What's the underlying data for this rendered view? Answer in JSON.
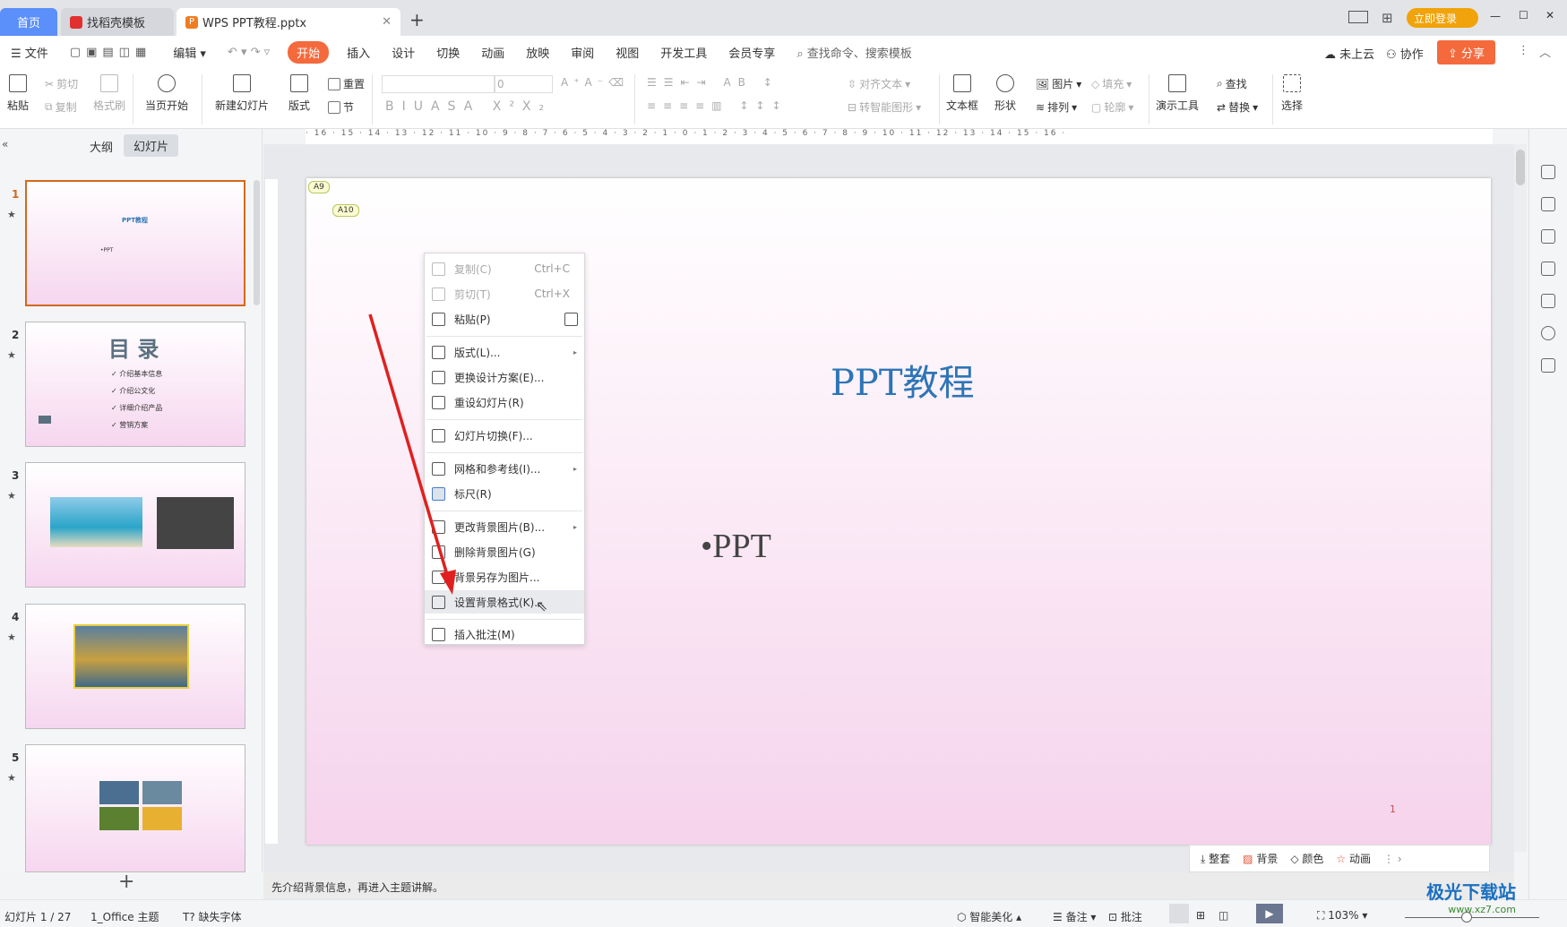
{
  "tabs": {
    "home": "首页",
    "template": "找稻壳模板",
    "doc": "WPS PPT教程.pptx",
    "add": "+"
  },
  "titlebar": {
    "login": "立即登录",
    "min": "—",
    "max": "☐",
    "close": "✕"
  },
  "menu": {
    "file": "文件",
    "edit": "编辑",
    "items": [
      "开始",
      "插入",
      "设计",
      "切换",
      "动画",
      "放映",
      "审阅",
      "视图",
      "开发工具",
      "会员专享"
    ],
    "search": "查找命令、搜索模板",
    "cloud": "未上云",
    "collab": "协作",
    "share": "分享"
  },
  "ribbon": {
    "paste": "粘贴",
    "cut": "剪切",
    "copy": "复制",
    "format_painter": "格式刷",
    "from_start": "当页开始",
    "new_slide": "新建幻灯片",
    "layout": "版式",
    "reset": "重置",
    "section": "节",
    "font_size": "0",
    "align_text": "对齐文本",
    "smart_shape": "转智能图形",
    "textbox": "文本框",
    "shape": "形状",
    "picture": "图片",
    "arrange": "排列",
    "fill": "填充",
    "outline": "轮廓",
    "present_tools": "演示工具",
    "find": "查找",
    "replace": "替换",
    "select": "选择"
  },
  "panel": {
    "outline_tab": "大纲",
    "slides_tab": "幻灯片",
    "add": "+"
  },
  "slides": [
    {
      "num": "1",
      "title": "PPT教程",
      "bullet": "•PPT"
    },
    {
      "num": "2",
      "title": "目 录",
      "items": [
        "✓ 介绍基本信息",
        "✓ 介绍公文化",
        "✓ 详细介绍产品",
        "✓ 营销方案"
      ]
    },
    {
      "num": "3"
    },
    {
      "num": "4"
    },
    {
      "num": "5"
    }
  ],
  "ruler": "· 16 · 15 · 14 · 13 · 12 · 11 · 10 · 9 · 8 · 7 · 6 · 5 · 4 · 3 · 2 · 1 · 0 · 1 · 2 · 3 · 4 · 5 · 6 · 7 · 8 · 9 · 10 · 11 · 12 · 13 · 14 · 15 · 16 ·",
  "slide": {
    "title": "PPT教程",
    "bullet": "•PPT",
    "page": "1",
    "comments": [
      "A9",
      "A10"
    ]
  },
  "context_menu": [
    {
      "label": "复制(C)",
      "shortcut": "Ctrl+C",
      "disabled": true
    },
    {
      "label": "剪切(T)",
      "shortcut": "Ctrl+X",
      "disabled": true
    },
    {
      "label": "粘贴(P)"
    },
    {
      "label": "版式(L)..."
    },
    {
      "label": "更换设计方案(E)..."
    },
    {
      "label": "重设幻灯片(R)"
    },
    {
      "label": "幻灯片切换(F)..."
    },
    {
      "label": "网格和参考线(I)..."
    },
    {
      "label": "标尺(R)"
    },
    {
      "label": "更改背景图片(B)..."
    },
    {
      "label": "删除背景图片(G)"
    },
    {
      "label": "背景另存为图片..."
    },
    {
      "label": "设置背景格式(K)...",
      "highlighted": true
    },
    {
      "label": "插入批注(M)"
    }
  ],
  "floatbar": {
    "items": [
      "整套",
      "背景",
      "颜色",
      "动画"
    ]
  },
  "notes": "先介绍背景信息，再进入主题讲解。",
  "status": {
    "slide": "幻灯片 1 / 27",
    "theme": "1_Office 主题",
    "font": "缺失字体",
    "beautify": "智能美化",
    "notes": "备注",
    "comment": "批注",
    "zoom": "103%"
  },
  "watermark": {
    "text": "极光下载站",
    "url": "www.xz7.com"
  },
  "colors": {
    "accent": "#f46a3d",
    "tab_home": "#5b8ff9",
    "title": "#2e75b6",
    "arrow": "#e02020",
    "selected_border": "#d2691e"
  }
}
